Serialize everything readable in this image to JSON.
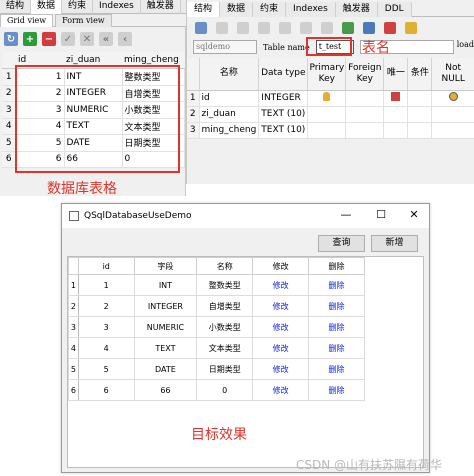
{
  "left_panel": {
    "tabs": [
      "结构",
      "数据",
      "约束",
      "Indexes",
      "触发器"
    ],
    "subtabs": [
      "Grid view",
      "Form view"
    ],
    "columns": [
      "id",
      "zi_duan",
      "ming_cheng"
    ],
    "rows": [
      {
        "rn": "1",
        "id": "1",
        "zi_duan": "INT",
        "ming_cheng": "整数类型"
      },
      {
        "rn": "2",
        "id": "2",
        "zi_duan": "INTEGER",
        "ming_cheng": "自增类型"
      },
      {
        "rn": "3",
        "id": "3",
        "zi_duan": "NUMERIC",
        "ming_cheng": "小数类型"
      },
      {
        "rn": "4",
        "id": "4",
        "zi_duan": "TEXT",
        "ming_cheng": "文本类型"
      },
      {
        "rn": "5",
        "id": "5",
        "zi_duan": "DATE",
        "ming_cheng": "日期类型"
      },
      {
        "rn": "6",
        "id": "6",
        "zi_duan": "66",
        "ming_cheng": "0"
      }
    ],
    "annotation": "数据库表格"
  },
  "right_panel": {
    "tabs": [
      "结构",
      "数据",
      "约束",
      "Indexes",
      "触发器",
      "DDL"
    ],
    "db_combo": "sqldemo",
    "table_name_label": "Table name",
    "table_name_value": "t_test",
    "load_label": "load",
    "annotation": "表名",
    "columns": [
      "名称",
      "Data type",
      "Primary Key",
      "Foreign Key",
      "唯一",
      "条件",
      "Not NULL"
    ],
    "rows": [
      {
        "rn": "1",
        "name": "id",
        "type": "INTEGER"
      },
      {
        "rn": "2",
        "name": "zi_duan",
        "type": "TEXT (10)"
      },
      {
        "rn": "3",
        "name": "ming_cheng",
        "type": "TEXT (10)"
      }
    ]
  },
  "dialog": {
    "title": "QSqlDatabaseUseDemo",
    "btn_query": "查询",
    "btn_add": "新增",
    "columns": [
      "id",
      "字段",
      "名称",
      "修改",
      "删除"
    ],
    "rows": [
      {
        "rn": "1",
        "id": "1",
        "field": "INT",
        "name": "整数类型",
        "edit": "修改",
        "del": "删除"
      },
      {
        "rn": "2",
        "id": "2",
        "field": "INTEGER",
        "name": "自增类型",
        "edit": "修改",
        "del": "删除"
      },
      {
        "rn": "3",
        "id": "3",
        "field": "NUMERIC",
        "name": "小数类型",
        "edit": "修改",
        "del": "删除"
      },
      {
        "rn": "4",
        "id": "4",
        "field": "TEXT",
        "name": "文本类型",
        "edit": "修改",
        "del": "删除"
      },
      {
        "rn": "5",
        "id": "5",
        "field": "DATE",
        "name": "日期类型",
        "edit": "修改",
        "del": "删除"
      },
      {
        "rn": "6",
        "id": "6",
        "field": "66",
        "name": "0",
        "edit": "修改",
        "del": "删除"
      }
    ],
    "annotation": "目标效果"
  },
  "watermark": "CSDN @山有扶苏隰有荷华",
  "colors": {
    "annotation_red": "#e0332b",
    "link_blue": "#0b20d9"
  }
}
